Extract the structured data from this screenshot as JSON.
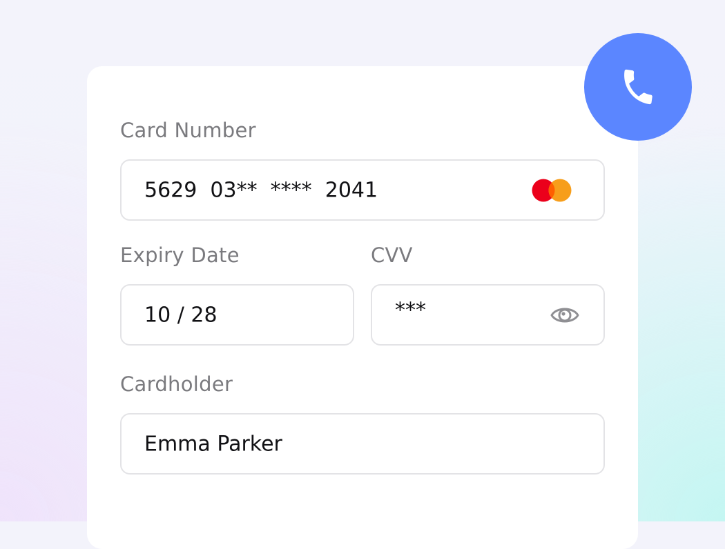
{
  "form": {
    "card_number": {
      "label": "Card Number",
      "value": "5629  03**  ****  2041",
      "brand_icon": "mastercard-icon"
    },
    "expiry": {
      "label": "Expiry Date",
      "value": "10 / 28"
    },
    "cvv": {
      "label": "CVV",
      "value": "***",
      "toggle_icon": "eye-icon"
    },
    "cardholder": {
      "label": "Cardholder",
      "value": "Emma Parker"
    }
  },
  "call_button": {
    "icon": "phone-icon"
  },
  "colors": {
    "accent": "#5b86ff",
    "mastercard_red": "#eb001b",
    "mastercard_orange": "#f79e1b",
    "label_text": "#7a7a7e",
    "value_text": "#111114",
    "field_border": "#e3e3e6"
  }
}
